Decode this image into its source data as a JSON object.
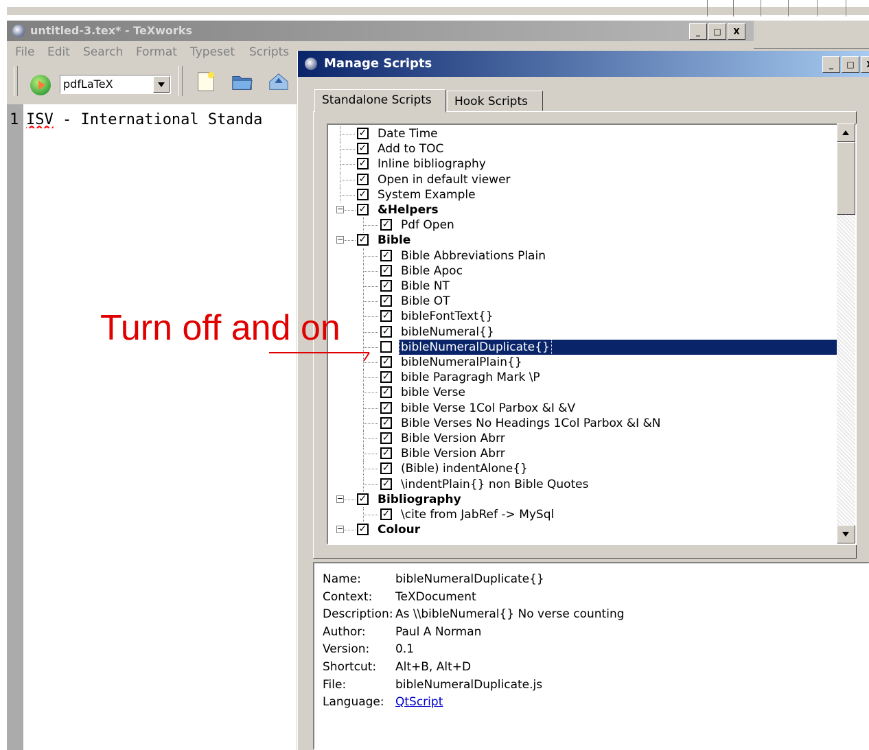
{
  "texworks": {
    "title": "untitled-3.tex* - TeXworks",
    "menu": [
      "File",
      "Edit",
      "Search",
      "Format",
      "Typeset",
      "Scripts"
    ],
    "engine": "pdfLaTeX",
    "line_number": "1",
    "editor_word": "ISV",
    "editor_rest": " - International Standa"
  },
  "window_buttons": {
    "minimize": "_",
    "maximize": "□",
    "close": "X"
  },
  "dialog": {
    "title": "Manage Scripts",
    "tabs": [
      {
        "label": "Standalone Scripts",
        "active": true
      },
      {
        "label": "Hook Scripts",
        "active": false
      }
    ],
    "tree": [
      {
        "label": "Date Time",
        "checked": true,
        "level": 0,
        "group": false
      },
      {
        "label": "Add to TOC",
        "checked": true,
        "level": 0,
        "group": false
      },
      {
        "label": "Inline bibliography",
        "checked": true,
        "level": 0,
        "group": false
      },
      {
        "label": "Open in default viewer",
        "checked": true,
        "level": 0,
        "group": false
      },
      {
        "label": "System Example",
        "checked": true,
        "level": 0,
        "group": false
      },
      {
        "label": "&Helpers",
        "checked": true,
        "level": 0,
        "group": true
      },
      {
        "label": "Pdf Open",
        "checked": true,
        "level": 1,
        "group": false
      },
      {
        "label": "Bible",
        "checked": true,
        "level": 0,
        "group": true
      },
      {
        "label": "Bible Abbreviations Plain",
        "checked": true,
        "level": 1,
        "group": false
      },
      {
        "label": "Bible Apoc",
        "checked": true,
        "level": 1,
        "group": false
      },
      {
        "label": "Bible NT",
        "checked": true,
        "level": 1,
        "group": false
      },
      {
        "label": "Bible OT",
        "checked": true,
        "level": 1,
        "group": false
      },
      {
        "label": "bibleFontText{}",
        "checked": true,
        "level": 1,
        "group": false
      },
      {
        "label": "bibleNumeral{}",
        "checked": true,
        "level": 1,
        "group": false
      },
      {
        "label": "bibleNumeralDuplicate{}",
        "checked": false,
        "level": 1,
        "group": false,
        "selected": true
      },
      {
        "label": "bibleNumeralPlain{}",
        "checked": true,
        "level": 1,
        "group": false
      },
      {
        "label": "bible Paragragh Mark \\P",
        "checked": true,
        "level": 1,
        "group": false
      },
      {
        "label": "bible Verse",
        "checked": true,
        "level": 1,
        "group": false
      },
      {
        "label": "bible Verse 1Col Parbox &I &V",
        "checked": true,
        "level": 1,
        "group": false
      },
      {
        "label": "Bible Verses No Headings 1Col Parbox &I &N",
        "checked": true,
        "level": 1,
        "group": false
      },
      {
        "label": "Bible Version Abrr",
        "checked": true,
        "level": 1,
        "group": false
      },
      {
        "label": "Bible Version Abrr",
        "checked": true,
        "level": 1,
        "group": false
      },
      {
        "label": "(Bible) indentAlone{}",
        "checked": true,
        "level": 1,
        "group": false
      },
      {
        "label": "\\indentPlain{} non Bible Quotes",
        "checked": true,
        "level": 1,
        "group": false
      },
      {
        "label": "Bibliography",
        "checked": true,
        "level": 0,
        "group": true
      },
      {
        "label": "\\cite from JabRef -> MySql",
        "checked": true,
        "level": 1,
        "group": false
      },
      {
        "label": "Colour",
        "checked": true,
        "level": 0,
        "group": true
      }
    ],
    "info": [
      {
        "key": "Name:",
        "value": "bibleNumeralDuplicate{}"
      },
      {
        "key": "Context:",
        "value": "TeXDocument"
      },
      {
        "key": "Description:",
        "value": "As \\\\bibleNumeral{} No verse counting"
      },
      {
        "key": "Author:",
        "value": "Paul A Norman"
      },
      {
        "key": "Version:",
        "value": "0.1"
      },
      {
        "key": "Shortcut:",
        "value": "Alt+B, Alt+D"
      },
      {
        "key": "File:",
        "value": "bibleNumeralDuplicate.js"
      },
      {
        "key": "Language:",
        "value": "QtScript",
        "link": true
      }
    ]
  },
  "annotation": {
    "text": "Turn off and on",
    "color": "#e00000"
  },
  "colors": {
    "selection": "#0a246a",
    "titlebar_active": "#0a246a",
    "titlebar_inactive": "#808080",
    "face": "#d4d0c8"
  },
  "icons": [
    "texworks-app-icon",
    "typeset-play-icon",
    "new-document-icon",
    "open-folder-icon",
    "save-icon",
    "checkbox-icon",
    "tree-expander-icon",
    "scroll-up-icon",
    "scroll-down-icon",
    "annotation-arrow-icon"
  ]
}
